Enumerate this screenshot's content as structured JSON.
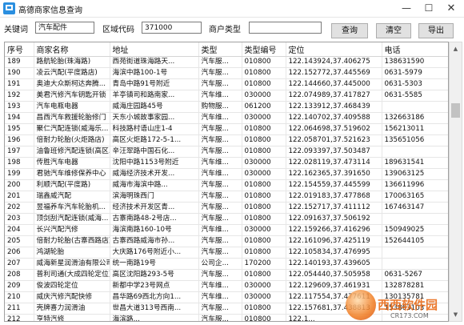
{
  "window": {
    "title": "高德商家信息查询",
    "min": "—",
    "max": "☐",
    "close": "✕"
  },
  "search": {
    "keyword_label": "关键词",
    "keyword_value": "汽车配件",
    "area_label": "区域代码",
    "area_value": "371000",
    "type_label": "商户类型",
    "type_value": "",
    "query_label": "查询",
    "clear_label": "清空",
    "export_label": "导出"
  },
  "table": {
    "headers": [
      "序号",
      "商家名称",
      "地址",
      "类型",
      "类型编号",
      "定位",
      "电话"
    ],
    "rows": [
      [
        "189",
        "路航轮胎(珠海路)",
        "西苑街道珠海路天...",
        "汽车服...",
        "010800",
        "122.143924,37.406275",
        "138631590"
      ],
      [
        "190",
        "凌云汽配(平度路店)",
        "海滨中路100-1号",
        "汽车服...",
        "010800",
        "122.152772,37.445569",
        "0631-5979"
      ],
      [
        "191",
        "奥迪大众斯柯达奔腾...",
        "青岛中路91号附近",
        "汽车服...",
        "010800",
        "122.144660,37.445000",
        "0631-5303"
      ],
      [
        "192",
        "美君汽修汽车钥匙开锁",
        "羊亭镇司和路南家...",
        "汽车维...",
        "030000",
        "122.074989,37.417827",
        "0631-5585"
      ],
      [
        "193",
        "汽车电瓶电器",
        "威海庄园路45号",
        "购物服...",
        "061200",
        "122.133912,37.468439",
        ""
      ],
      [
        "194",
        "昌西汽车救援轮胎修门",
        "天东小城故事家园...",
        "汽车维...",
        "030000",
        "122.140702,37.409588",
        "132663186"
      ],
      [
        "195",
        "聚仁汽配连锁(威海乐...",
        "科技路村语山庄1-4",
        "汽车服...",
        "010800",
        "122.064698,37.519602",
        "156213011"
      ],
      [
        "196",
        "倍耐力轮胎(火炬路店)",
        "高区火炬路172-5-1...",
        "汽车服...",
        "010800",
        "122.058701,37.521623",
        "135651056"
      ],
      [
        "197",
        "油鲁班修汽配连锁(高区...",
        "辛汪翠路中国石化...",
        "汽车服...",
        "010800",
        "122.093397,37.503487",
        ""
      ],
      [
        "198",
        "传胜汽车电器",
        "沈阳中路1153号附近",
        "汽车维...",
        "030000",
        "122.028119,37.473114",
        "189631541"
      ],
      [
        "199",
        "君驰汽车维修保养中心",
        "威海经济技术开发...",
        "汽车维...",
        "030000",
        "122.162365,37.391650",
        "139063125"
      ],
      [
        "200",
        "利顺汽配(平度路)",
        "威海市海滨中路...",
        "汽车服...",
        "010800",
        "122.154559,37.445599",
        "136611996"
      ],
      [
        "201",
        "瑞鑫威汽配",
        "滨海明珠西门",
        "汽车服...",
        "010800",
        "122.019183,37.477868",
        "170063165"
      ],
      [
        "202",
        "昱福养车汽车轮胎机...",
        "经济技术开发区青...",
        "汽车服...",
        "010800",
        "122.152717,37.411112",
        "167463147"
      ],
      [
        "203",
        "顶剑刮汽配连锁(威海...",
        "古寨南路48-2号店...",
        "汽车服...",
        "010800",
        "122.091637,37.506192",
        ""
      ],
      [
        "204",
        "长兴汽配汽修",
        "海滨南路160-10号",
        "汽车维...",
        "030000",
        "122.159266,37.416296",
        "150949025"
      ],
      [
        "205",
        "倍耐力轮胎(古寨西路店)",
        "古寨西路威海市孙...",
        "汽车服...",
        "010800",
        "122.161096,37.425119",
        "152644105"
      ],
      [
        "206",
        "鸿湖轮胎",
        "大庆路176号附近小...",
        "汽车服...",
        "010800",
        "122.105834,37.476995",
        ""
      ],
      [
        "207",
        "威海新星润滑油有限公司",
        "统一南路19号",
        "公司企...",
        "170200",
        "122.140193,37.439605",
        ""
      ],
      [
        "208",
        "普利司通(大成四轮定位)",
        "高区沈阳路293-5号",
        "汽车服...",
        "010800",
        "122.054440,37.505958",
        "0631-5267"
      ],
      [
        "209",
        "俊波四轮定位",
        "新都中学23号网点",
        "汽车维...",
        "030000",
        "122.129609,37.461931",
        "132878281"
      ],
      [
        "210",
        "威庆汽修汽配快修",
        "昌华路69西北方向1...",
        "汽车维...",
        "030000",
        "122.117554,37.477611",
        "130135781"
      ],
      [
        "211",
        "壳牌喜力润滑油",
        "世昌大道313号西南...",
        "汽车服...",
        "010800",
        "122.157681,37.438813",
        "153863103"
      ],
      [
        "212",
        "亨特汽修",
        "海滨路...",
        "汽车服...",
        "010800",
        "122.1...",
        ""
      ]
    ]
  },
  "watermark": {
    "text": "西西软件园",
    "url": "CR173.COM"
  }
}
